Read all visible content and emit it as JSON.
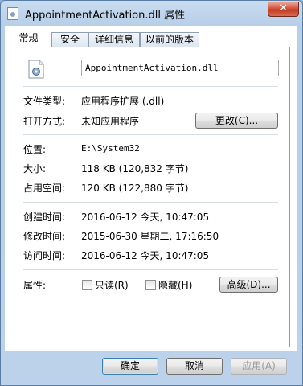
{
  "window": {
    "title": "AppointmentActivation.dll 属性",
    "close_glyph": "✕"
  },
  "tabs": [
    "常规",
    "安全",
    "详细信息",
    "以前的版本"
  ],
  "file_name": "AppointmentActivation.dll",
  "rows": {
    "type_label": "文件类型:",
    "type_value": "应用程序扩展 (.dll)",
    "open_label": "打开方式:",
    "open_value": "未知应用程序",
    "change_button": "更改(C)...",
    "location_label": "位置:",
    "location_value": "E:\\System32",
    "size_label": "大小:",
    "size_value": "118 KB (120,832 字节)",
    "disk_label": "占用空间:",
    "disk_value": "120 KB (122,880 字节)",
    "created_label": "创建时间:",
    "created_value": "2016-06-12 今天, 10:47:05",
    "modified_label": "修改时间:",
    "modified_value": "2015-06-30 星期二, 17:16:50",
    "accessed_label": "访问时间:",
    "accessed_value": "2016-06-12 今天, 10:47:05",
    "attr_label": "属性:",
    "readonly_label": "只读(R)",
    "hidden_label": "隐藏(H)",
    "advanced_button": "高级(D)..."
  },
  "footer": {
    "ok": "确定",
    "cancel": "取消",
    "apply": "应用(A)"
  },
  "icons": [
    "file-icon",
    "close-icon",
    "dll-gear-icon"
  ]
}
